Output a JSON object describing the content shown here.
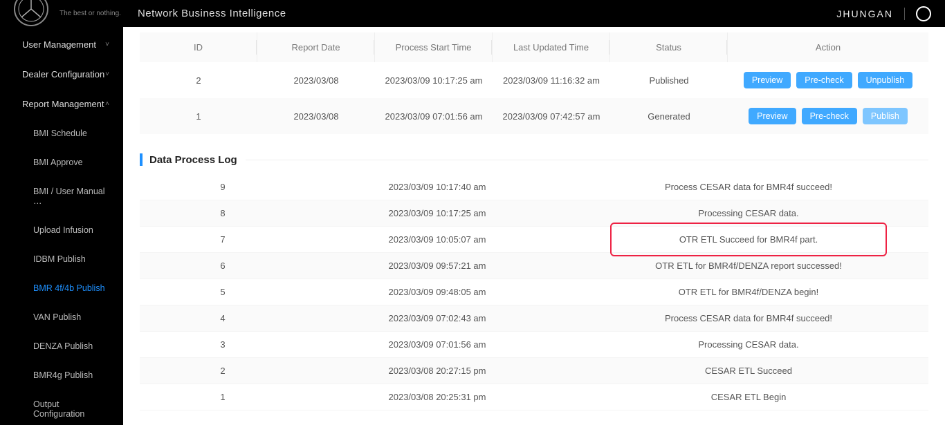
{
  "header": {
    "tagline": "The best or nothing.",
    "app_title": "Network Business Intelligence",
    "username": "JHUNGAN"
  },
  "sidebar": {
    "items": [
      {
        "label": "User Management",
        "expanded": false
      },
      {
        "label": "Dealer Configuration",
        "expanded": false
      },
      {
        "label": "Report Management",
        "expanded": true,
        "children": [
          {
            "label": "BMI Schedule"
          },
          {
            "label": "BMI Approve"
          },
          {
            "label": "BMI / User Manual …"
          },
          {
            "label": "Upload Infusion"
          },
          {
            "label": "IDBM Publish"
          },
          {
            "label": "BMR 4f/4b Publish",
            "active": true
          },
          {
            "label": "VAN Publish"
          },
          {
            "label": "DENZA Publish"
          },
          {
            "label": "BMR4g Publish"
          },
          {
            "label": "Output Configuration"
          }
        ]
      }
    ]
  },
  "reports_table": {
    "columns": [
      "ID",
      "Report Date",
      "Process Start Time",
      "Last Updated Time",
      "Status",
      "Action"
    ],
    "rows": [
      {
        "id": "2",
        "date": "2023/03/08",
        "start": "2023/03/09 10:17:25 am",
        "updated": "2023/03/09 11:16:32 am",
        "status": "Published",
        "actions": [
          "Preview",
          "Pre-check",
          "Unpublish"
        ]
      },
      {
        "id": "1",
        "date": "2023/03/08",
        "start": "2023/03/09 07:01:56 am",
        "updated": "2023/03/09 07:42:57 am",
        "status": "Generated",
        "actions": [
          "Preview",
          "Pre-check",
          "Publish"
        ]
      }
    ]
  },
  "log_section_title": "Data Process Log",
  "log_table": {
    "rows": [
      {
        "id": "9",
        "time": "2023/03/09 10:17:40 am",
        "msg": "Process CESAR data for BMR4f succeed!"
      },
      {
        "id": "8",
        "time": "2023/03/09 10:17:25 am",
        "msg": "Processing CESAR data."
      },
      {
        "id": "7",
        "time": "2023/03/09 10:05:07 am",
        "msg": "OTR ETL Succeed for BMR4f part.",
        "highlight": true
      },
      {
        "id": "6",
        "time": "2023/03/09 09:57:21 am",
        "msg": "OTR ETL for BMR4f/DENZA report successed!"
      },
      {
        "id": "5",
        "time": "2023/03/09 09:48:05 am",
        "msg": "OTR ETL for BMR4f/DENZA begin!"
      },
      {
        "id": "4",
        "time": "2023/03/09 07:02:43 am",
        "msg": "Process CESAR data for BMR4f succeed!"
      },
      {
        "id": "3",
        "time": "2023/03/09 07:01:56 am",
        "msg": "Processing CESAR data."
      },
      {
        "id": "2",
        "time": "2023/03/08 20:27:15 pm",
        "msg": "CESAR ETL Succeed"
      },
      {
        "id": "1",
        "time": "2023/03/08 20:25:31 pm",
        "msg": "CESAR ETL Begin"
      }
    ]
  }
}
